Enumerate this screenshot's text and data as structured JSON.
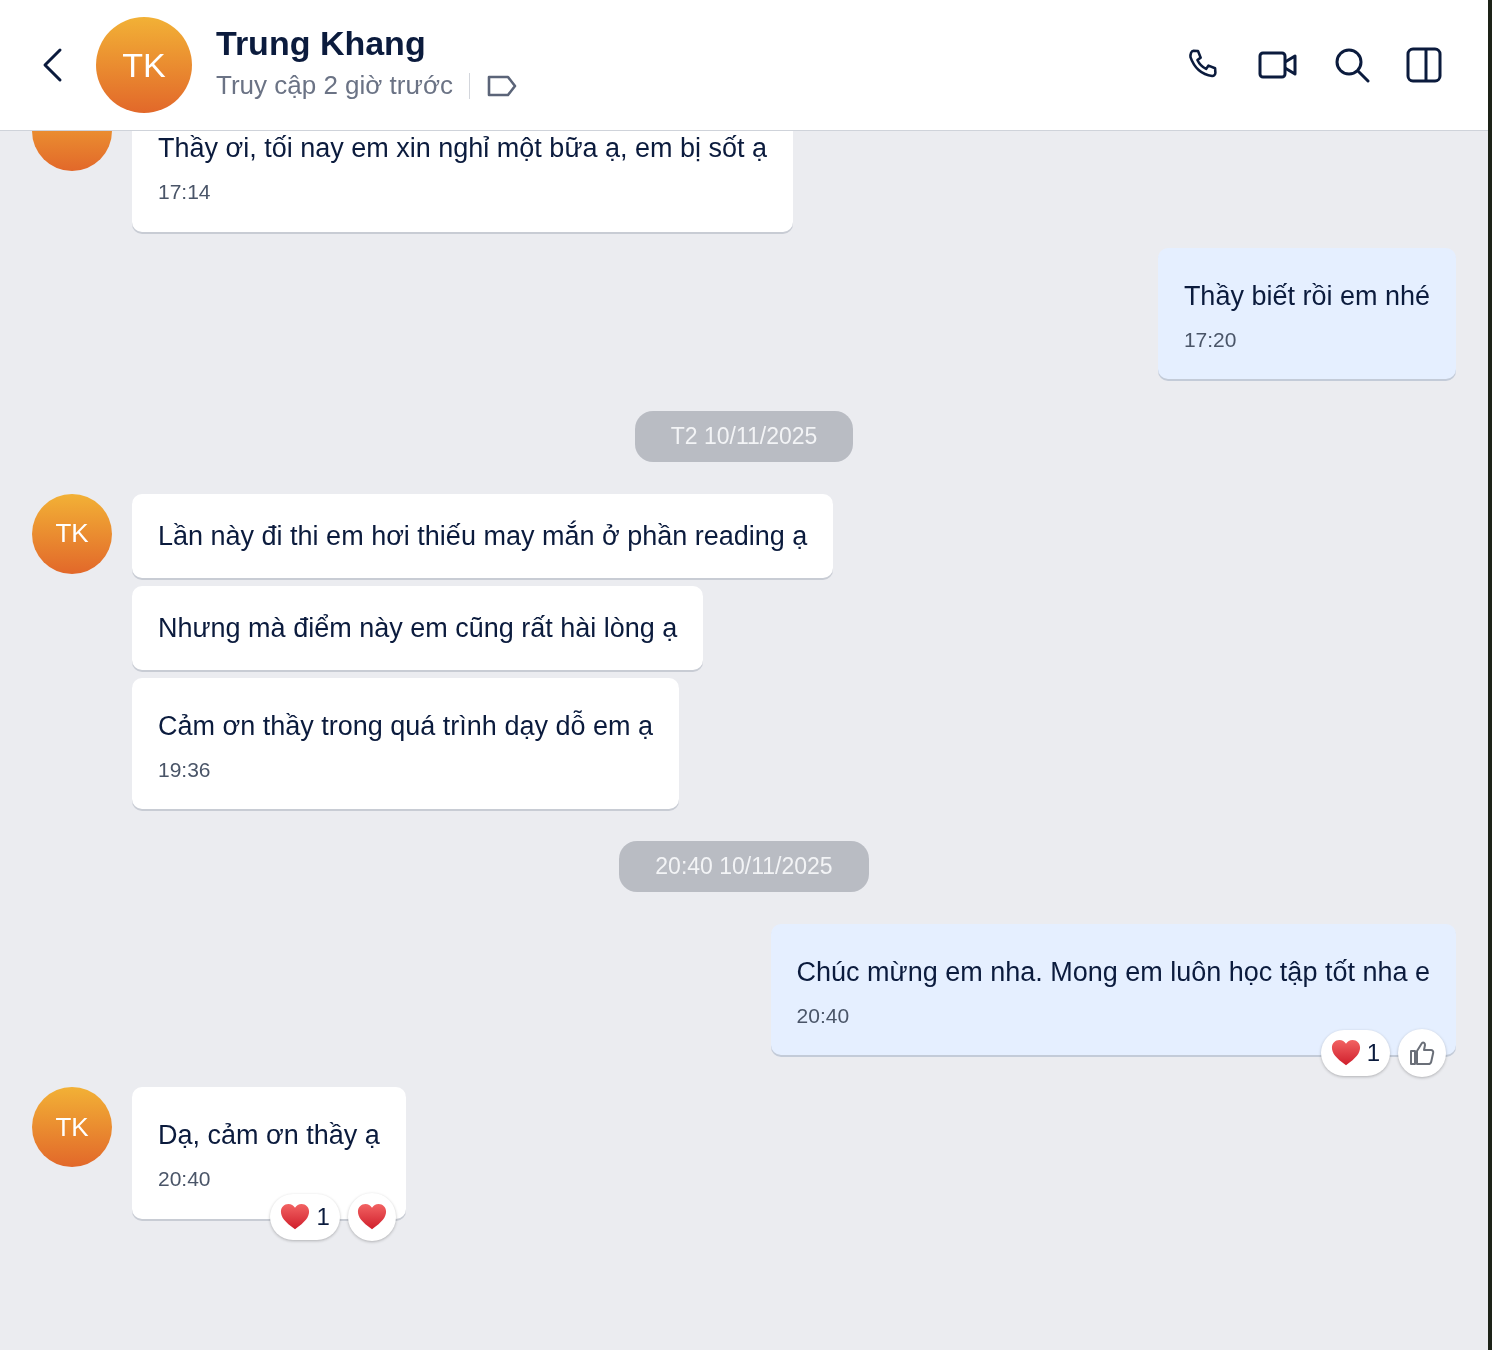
{
  "header": {
    "avatar": "TK",
    "name": "Trung Khang",
    "status": "Truy cập 2 giờ trước"
  },
  "messages": [
    {
      "kind": "incoming",
      "avatar": {
        "visible": true
      },
      "bubbles": [
        {
          "text": "Thầy ơi, tối nay em xin nghỉ một bữa ạ, em bị sốt ạ",
          "time": "17:14"
        }
      ]
    },
    {
      "kind": "outgoing",
      "bubbles": [
        {
          "text": "Thầy biết rồi em nhé",
          "time": "17:20"
        }
      ]
    },
    {
      "kind": "divider",
      "text": "T2 10/11/2025"
    },
    {
      "kind": "incoming",
      "avatar": {
        "visible": true,
        "initials": "TK"
      },
      "bubbles": [
        {
          "text": "Lần này đi thi em hơi thiếu may mắn ở phần reading ạ"
        },
        {
          "text": "Nhưng mà điểm này em cũng rất hài lòng ạ"
        },
        {
          "text": "Cảm ơn thầy trong quá trình dạy dỗ em ạ",
          "time": "19:36"
        }
      ]
    },
    {
      "kind": "divider",
      "text": "20:40 10/11/2025"
    },
    {
      "kind": "outgoing",
      "bubbles": [
        {
          "text": "Chúc mừng em nha. Mong em luôn học tập tốt nha e",
          "time": "20:40",
          "reactions": [
            {
              "kind": "heart",
              "count": "1"
            }
          ],
          "quick": {
            "kind": "like"
          }
        }
      ]
    },
    {
      "kind": "incoming",
      "avatar": {
        "visible": true,
        "initials": "TK"
      },
      "bubbles": [
        {
          "text": "Dạ, cảm ơn thầy ạ",
          "time": "20:40",
          "reactions": [
            {
              "kind": "heart",
              "count": "1"
            }
          ],
          "quick": {
            "kind": "heart"
          }
        }
      ]
    }
  ]
}
